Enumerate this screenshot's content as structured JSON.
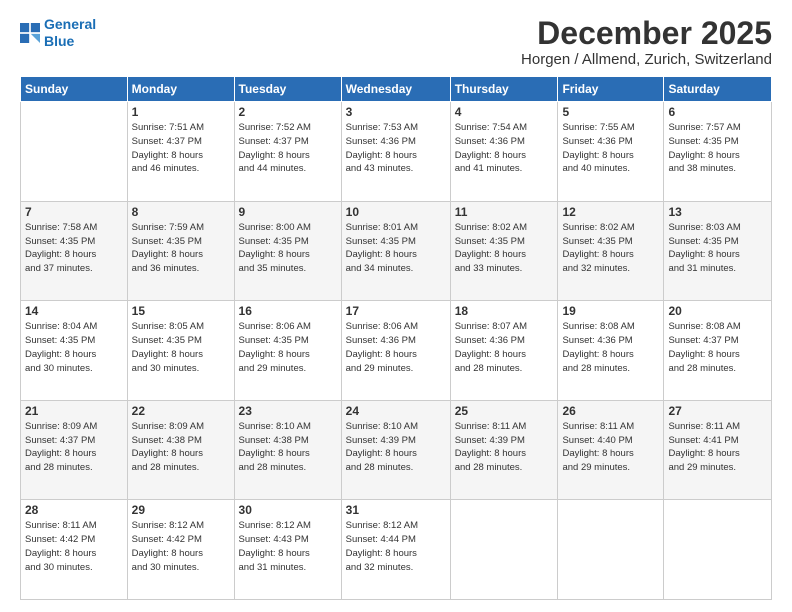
{
  "logo": {
    "line1": "General",
    "line2": "Blue"
  },
  "title": "December 2025",
  "location": "Horgen / Allmend, Zurich, Switzerland",
  "weekdays": [
    "Sunday",
    "Monday",
    "Tuesday",
    "Wednesday",
    "Thursday",
    "Friday",
    "Saturday"
  ],
  "weeks": [
    [
      {
        "day": "",
        "info": ""
      },
      {
        "day": "1",
        "info": "Sunrise: 7:51 AM\nSunset: 4:37 PM\nDaylight: 8 hours\nand 46 minutes."
      },
      {
        "day": "2",
        "info": "Sunrise: 7:52 AM\nSunset: 4:37 PM\nDaylight: 8 hours\nand 44 minutes."
      },
      {
        "day": "3",
        "info": "Sunrise: 7:53 AM\nSunset: 4:36 PM\nDaylight: 8 hours\nand 43 minutes."
      },
      {
        "day": "4",
        "info": "Sunrise: 7:54 AM\nSunset: 4:36 PM\nDaylight: 8 hours\nand 41 minutes."
      },
      {
        "day": "5",
        "info": "Sunrise: 7:55 AM\nSunset: 4:36 PM\nDaylight: 8 hours\nand 40 minutes."
      },
      {
        "day": "6",
        "info": "Sunrise: 7:57 AM\nSunset: 4:35 PM\nDaylight: 8 hours\nand 38 minutes."
      }
    ],
    [
      {
        "day": "7",
        "info": "Sunrise: 7:58 AM\nSunset: 4:35 PM\nDaylight: 8 hours\nand 37 minutes."
      },
      {
        "day": "8",
        "info": "Sunrise: 7:59 AM\nSunset: 4:35 PM\nDaylight: 8 hours\nand 36 minutes."
      },
      {
        "day": "9",
        "info": "Sunrise: 8:00 AM\nSunset: 4:35 PM\nDaylight: 8 hours\nand 35 minutes."
      },
      {
        "day": "10",
        "info": "Sunrise: 8:01 AM\nSunset: 4:35 PM\nDaylight: 8 hours\nand 34 minutes."
      },
      {
        "day": "11",
        "info": "Sunrise: 8:02 AM\nSunset: 4:35 PM\nDaylight: 8 hours\nand 33 minutes."
      },
      {
        "day": "12",
        "info": "Sunrise: 8:02 AM\nSunset: 4:35 PM\nDaylight: 8 hours\nand 32 minutes."
      },
      {
        "day": "13",
        "info": "Sunrise: 8:03 AM\nSunset: 4:35 PM\nDaylight: 8 hours\nand 31 minutes."
      }
    ],
    [
      {
        "day": "14",
        "info": "Sunrise: 8:04 AM\nSunset: 4:35 PM\nDaylight: 8 hours\nand 30 minutes."
      },
      {
        "day": "15",
        "info": "Sunrise: 8:05 AM\nSunset: 4:35 PM\nDaylight: 8 hours\nand 30 minutes."
      },
      {
        "day": "16",
        "info": "Sunrise: 8:06 AM\nSunset: 4:35 PM\nDaylight: 8 hours\nand 29 minutes."
      },
      {
        "day": "17",
        "info": "Sunrise: 8:06 AM\nSunset: 4:36 PM\nDaylight: 8 hours\nand 29 minutes."
      },
      {
        "day": "18",
        "info": "Sunrise: 8:07 AM\nSunset: 4:36 PM\nDaylight: 8 hours\nand 28 minutes."
      },
      {
        "day": "19",
        "info": "Sunrise: 8:08 AM\nSunset: 4:36 PM\nDaylight: 8 hours\nand 28 minutes."
      },
      {
        "day": "20",
        "info": "Sunrise: 8:08 AM\nSunset: 4:37 PM\nDaylight: 8 hours\nand 28 minutes."
      }
    ],
    [
      {
        "day": "21",
        "info": "Sunrise: 8:09 AM\nSunset: 4:37 PM\nDaylight: 8 hours\nand 28 minutes."
      },
      {
        "day": "22",
        "info": "Sunrise: 8:09 AM\nSunset: 4:38 PM\nDaylight: 8 hours\nand 28 minutes."
      },
      {
        "day": "23",
        "info": "Sunrise: 8:10 AM\nSunset: 4:38 PM\nDaylight: 8 hours\nand 28 minutes."
      },
      {
        "day": "24",
        "info": "Sunrise: 8:10 AM\nSunset: 4:39 PM\nDaylight: 8 hours\nand 28 minutes."
      },
      {
        "day": "25",
        "info": "Sunrise: 8:11 AM\nSunset: 4:39 PM\nDaylight: 8 hours\nand 28 minutes."
      },
      {
        "day": "26",
        "info": "Sunrise: 8:11 AM\nSunset: 4:40 PM\nDaylight: 8 hours\nand 29 minutes."
      },
      {
        "day": "27",
        "info": "Sunrise: 8:11 AM\nSunset: 4:41 PM\nDaylight: 8 hours\nand 29 minutes."
      }
    ],
    [
      {
        "day": "28",
        "info": "Sunrise: 8:11 AM\nSunset: 4:42 PM\nDaylight: 8 hours\nand 30 minutes."
      },
      {
        "day": "29",
        "info": "Sunrise: 8:12 AM\nSunset: 4:42 PM\nDaylight: 8 hours\nand 30 minutes."
      },
      {
        "day": "30",
        "info": "Sunrise: 8:12 AM\nSunset: 4:43 PM\nDaylight: 8 hours\nand 31 minutes."
      },
      {
        "day": "31",
        "info": "Sunrise: 8:12 AM\nSunset: 4:44 PM\nDaylight: 8 hours\nand 32 minutes."
      },
      {
        "day": "",
        "info": ""
      },
      {
        "day": "",
        "info": ""
      },
      {
        "day": "",
        "info": ""
      }
    ]
  ]
}
